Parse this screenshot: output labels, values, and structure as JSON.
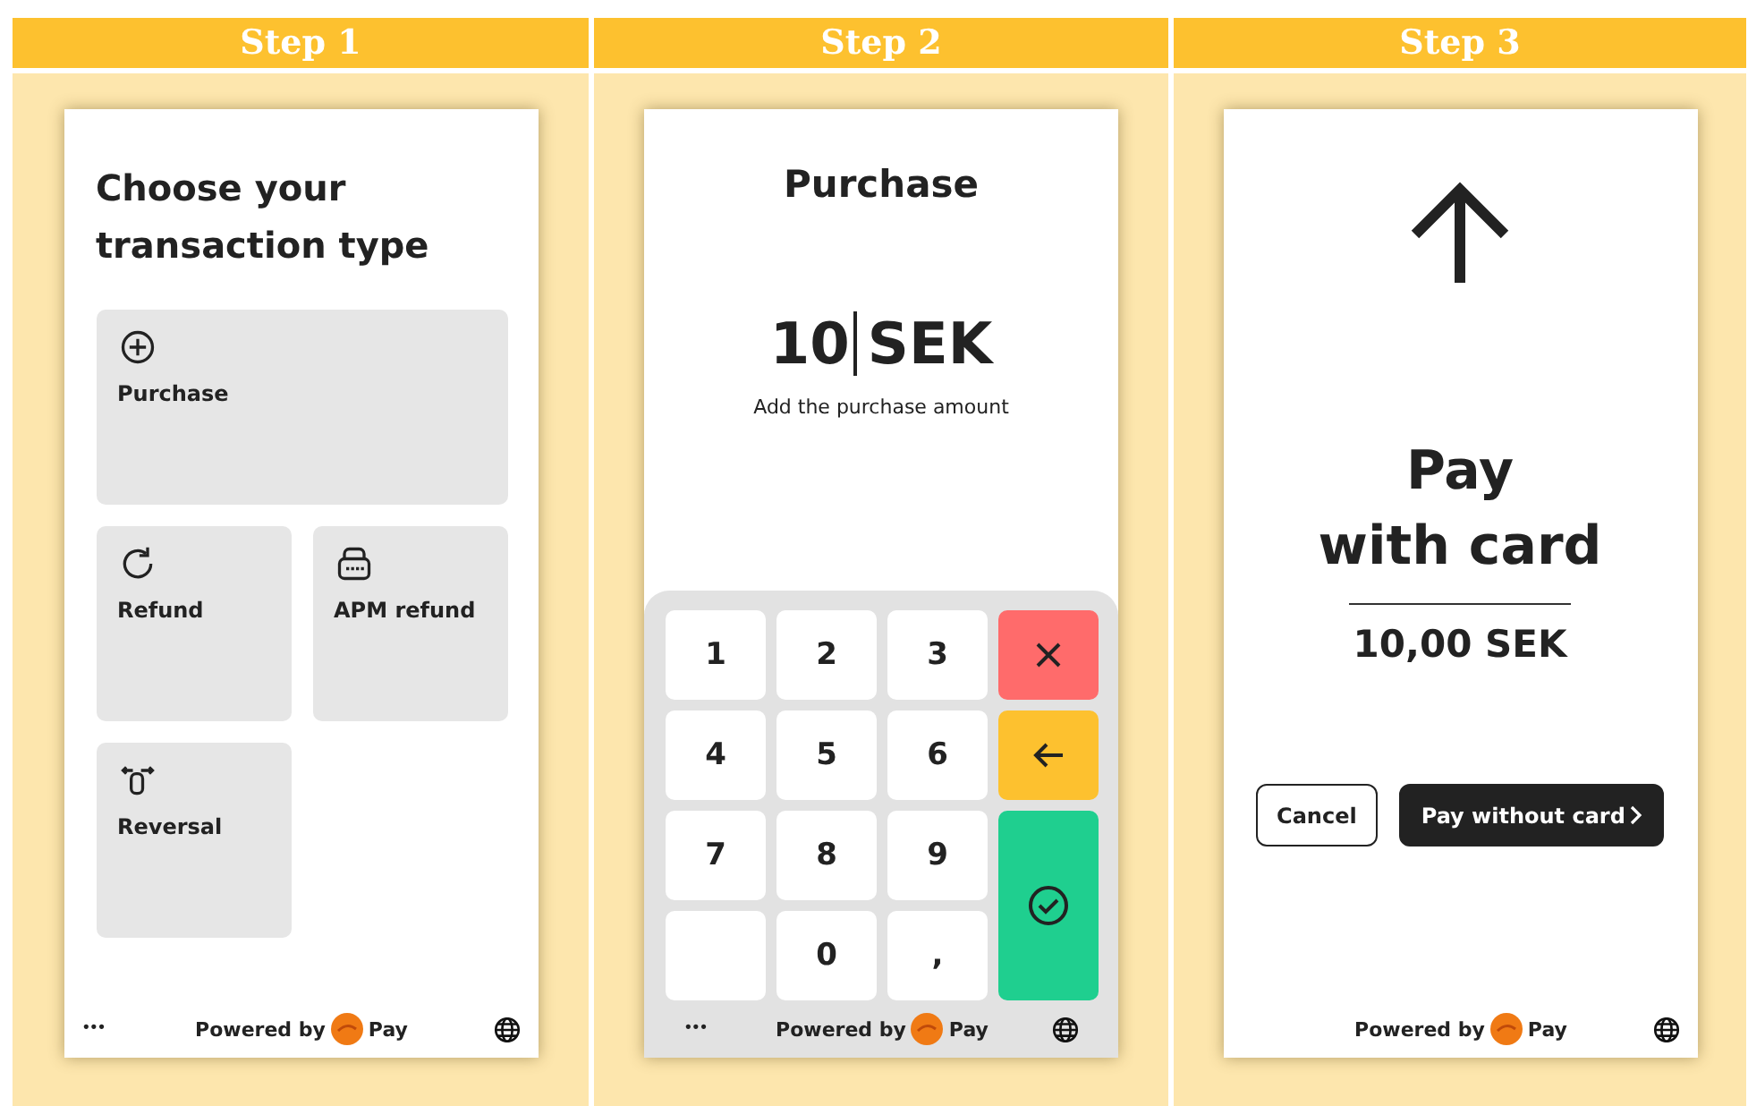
{
  "steps": [
    {
      "label": "Step 1",
      "kind": "type_select",
      "screen": {
        "title": "Choose your transaction type",
        "tiles": [
          {
            "label": "Purchase",
            "kind": "purchase"
          },
          {
            "label": "Refund",
            "kind": "refund"
          },
          {
            "label": "APM refund",
            "kind": "apm_refund"
          },
          {
            "label": "Reversal",
            "kind": "reversal"
          }
        ],
        "footer": {
          "menu": "•••",
          "powered_by": "Powered by",
          "brand": "Pay"
        }
      }
    },
    {
      "label": "Step 2",
      "kind": "amount_entry",
      "screen": {
        "title": "Purchase",
        "amount": "10",
        "currency": "SEK",
        "hint": "Add the purchase amount",
        "keys": [
          {
            "kind": "digit",
            "label": "1"
          },
          {
            "kind": "digit",
            "label": "2"
          },
          {
            "kind": "digit",
            "label": "3"
          },
          {
            "kind": "cancel"
          },
          {
            "kind": "digit",
            "label": "4"
          },
          {
            "kind": "digit",
            "label": "5"
          },
          {
            "kind": "digit",
            "label": "6"
          },
          {
            "kind": "back"
          },
          {
            "kind": "digit",
            "label": "7"
          },
          {
            "kind": "digit",
            "label": "8"
          },
          {
            "kind": "digit",
            "label": "9"
          },
          {
            "kind": "confirm"
          },
          {
            "kind": "empty"
          },
          {
            "kind": "digit",
            "label": "0"
          },
          {
            "kind": "digit",
            "label": ","
          }
        ],
        "footer": {
          "menu": "•••",
          "powered_by": "Powered by",
          "brand": "Pay"
        }
      }
    },
    {
      "label": "Step 3",
      "kind": "pay_card",
      "screen": {
        "title_line_1": "Pay",
        "title_line_2": "with card",
        "amount": "10,00 SEK",
        "cancel": "Cancel",
        "pay_without_card": "Pay without card",
        "footer": {
          "powered_by": "Powered by",
          "brand": "Pay"
        }
      }
    }
  ]
}
